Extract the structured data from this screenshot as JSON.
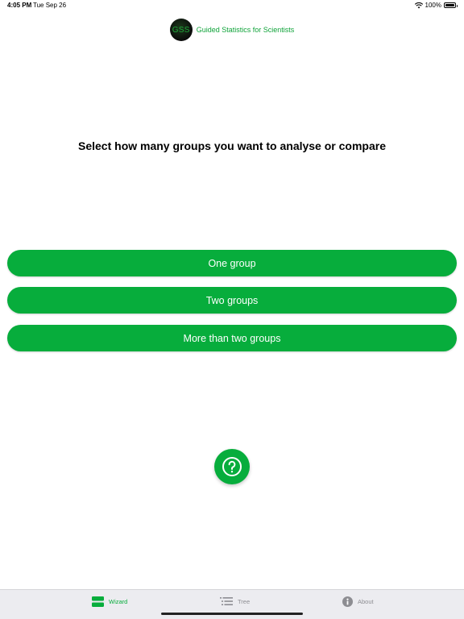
{
  "status_bar": {
    "time": "4:05 PM",
    "date": "Tue Sep 26",
    "battery": "100%",
    "battery_level": 1.0
  },
  "header": {
    "logo_text": "GSS",
    "title": "Guided Statistics for Scientists"
  },
  "main": {
    "prompt": "Select how many groups you want to analyse or compare",
    "options": [
      {
        "label": "One group"
      },
      {
        "label": "Two groups"
      },
      {
        "label": "More than two groups"
      }
    ],
    "help_icon": "question-circle-icon"
  },
  "tab_bar": {
    "items": [
      {
        "label": "Wizard",
        "icon": "wizard-icon",
        "selected": true
      },
      {
        "label": "Tree",
        "icon": "tree-list-icon",
        "selected": false
      },
      {
        "label": "About",
        "icon": "info-icon",
        "selected": false
      }
    ]
  },
  "colors": {
    "accent": "#07ad3c",
    "tab_inactive": "#8d8d92",
    "tab_bar_bg": "#ececf0"
  }
}
